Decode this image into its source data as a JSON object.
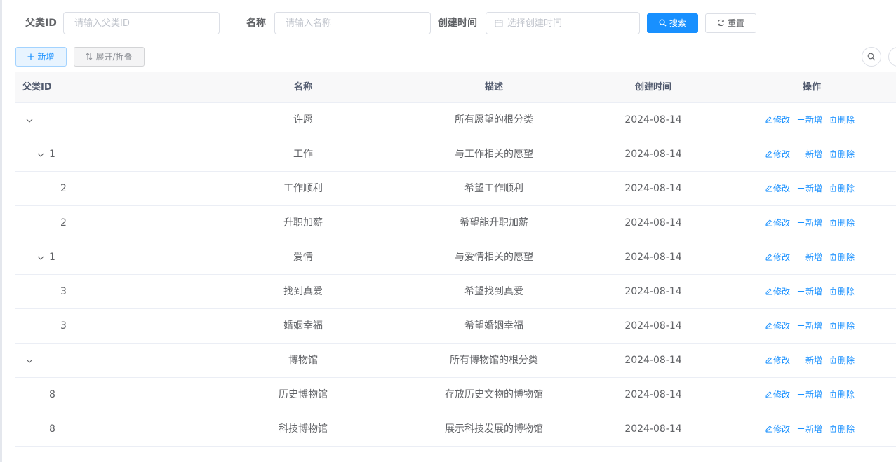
{
  "form": {
    "parent_id_label": "父类ID",
    "parent_id_placeholder": "请输入父类ID",
    "name_label": "名称",
    "name_placeholder": "请输入名称",
    "created_label": "创建时间",
    "created_placeholder": "选择创建时间",
    "search_button": "搜索",
    "reset_button": "重置"
  },
  "toolbar": {
    "add_button": "新增",
    "toggle_button": "展开/折叠"
  },
  "table": {
    "headers": {
      "parent_id": "父类ID",
      "name": "名称",
      "description": "描述",
      "created": "创建时间",
      "actions": "操作"
    },
    "actions": {
      "edit": "修改",
      "add": "新增",
      "delete": "删除"
    },
    "rows": [
      {
        "parent_id": "",
        "name": "许愿",
        "description": "所有愿望的根分类",
        "created": "2024-08-14"
      },
      {
        "parent_id": "1",
        "name": "工作",
        "description": "与工作相关的愿望",
        "created": "2024-08-14"
      },
      {
        "parent_id": "2",
        "name": "工作顺利",
        "description": "希望工作顺利",
        "created": "2024-08-14"
      },
      {
        "parent_id": "2",
        "name": "升职加薪",
        "description": "希望能升职加薪",
        "created": "2024-08-14"
      },
      {
        "parent_id": "1",
        "name": "爱情",
        "description": "与爱情相关的愿望",
        "created": "2024-08-14"
      },
      {
        "parent_id": "3",
        "name": "找到真爱",
        "description": "希望找到真爱",
        "created": "2024-08-14"
      },
      {
        "parent_id": "3",
        "name": "婚姻幸福",
        "description": "希望婚姻幸福",
        "created": "2024-08-14"
      },
      {
        "parent_id": "",
        "name": "博物馆",
        "description": "所有博物馆的根分类",
        "created": "2024-08-14"
      },
      {
        "parent_id": "8",
        "name": "历史博物馆",
        "description": "存放历史文物的博物馆",
        "created": "2024-08-14"
      },
      {
        "parent_id": "8",
        "name": "科技博物馆",
        "description": "展示科技发展的博物馆",
        "created": "2024-08-14"
      }
    ]
  },
  "colors": {
    "primary": "#1890ff",
    "border": "#ebeef5",
    "header_bg": "#f8f8f9",
    "text": "#606266"
  }
}
